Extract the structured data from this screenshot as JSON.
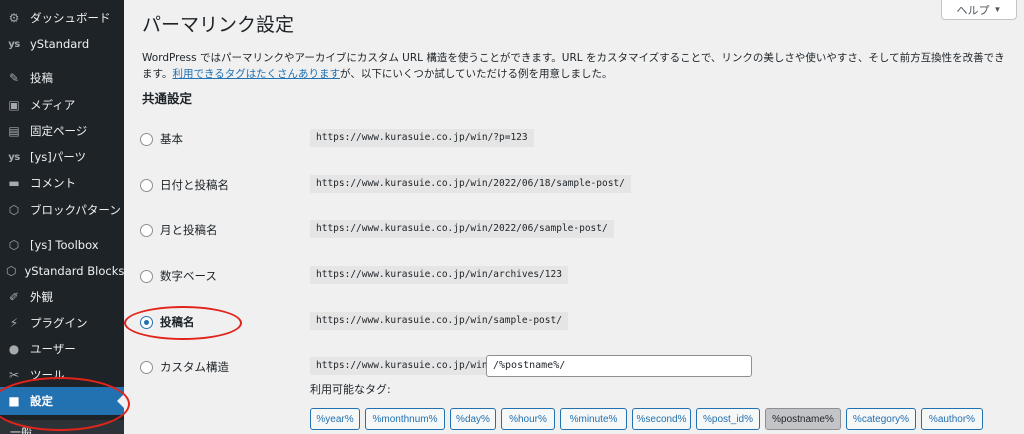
{
  "sidebar": {
    "items": [
      {
        "icon": "dashboard-icon",
        "glyph": "⚙",
        "label": "ダッシュボード"
      },
      {
        "icon": "ystandard-icon",
        "glyph": "ys",
        "label": "yStandard"
      },
      {
        "icon": "pin-icon",
        "glyph": "✎",
        "label": "投稿"
      },
      {
        "icon": "media-icon",
        "glyph": "▣",
        "label": "メディア"
      },
      {
        "icon": "page-icon",
        "glyph": "▤",
        "label": "固定ページ"
      },
      {
        "icon": "ys-parts-icon",
        "glyph": "ys",
        "label": "[ys]パーツ"
      },
      {
        "icon": "comment-icon",
        "glyph": "▬",
        "label": "コメント"
      },
      {
        "icon": "block-pattern-icon",
        "glyph": "⬡",
        "label": "ブロックパターン"
      },
      {
        "icon": "ys-toolbox-icon",
        "glyph": "⬡",
        "label": "[ys] Toolbox"
      },
      {
        "icon": "ystandard-blocks-icon",
        "glyph": "⬡",
        "label": "yStandard Blocks"
      },
      {
        "icon": "appearance-icon",
        "glyph": "✐",
        "label": "外観"
      },
      {
        "icon": "plugin-icon",
        "glyph": "⚡",
        "label": "プラグイン"
      },
      {
        "icon": "user-icon",
        "glyph": "●",
        "label": "ユーザー"
      },
      {
        "icon": "tools-icon",
        "glyph": "✂",
        "label": "ツール"
      },
      {
        "icon": "settings-icon",
        "glyph": "■",
        "label": "設定"
      }
    ],
    "submenu_label": "一般"
  },
  "header": {
    "title": "パーマリンク設定",
    "help_label": "ヘルプ",
    "help_arrow": "▼"
  },
  "intro": {
    "text_before": "WordPress ではパーマリンクやアーカイブにカスタム URL 構造を使うことができます。URL をカスタマイズすることで、リンクの美しさや使いやすさ、そして前方互換性を改善できます。",
    "link_text": "利用できるタグはたくさんあります",
    "text_after": "が、以下にいくつか試していただける例を用意しました。"
  },
  "common_settings": {
    "title": "共通設定",
    "options": [
      {
        "label": "基本",
        "url": "https://www.kurasuie.co.jp/win/?p=123",
        "checked": false
      },
      {
        "label": "日付と投稿名",
        "url": "https://www.kurasuie.co.jp/win/2022/06/18/sample-post/",
        "checked": false
      },
      {
        "label": "月と投稿名",
        "url": "https://www.kurasuie.co.jp/win/2022/06/sample-post/",
        "checked": false
      },
      {
        "label": "数字ベース",
        "url": "https://www.kurasuie.co.jp/win/archives/123",
        "checked": false
      },
      {
        "label": "投稿名",
        "url": "https://www.kurasuie.co.jp/win/sample-post/",
        "checked": true
      },
      {
        "label": "カスタム構造",
        "url": "https://www.kurasuie.co.jp/win",
        "checked": false
      }
    ],
    "custom_value": "/%postname%/",
    "tags_label": "利用可能なタグ:",
    "tags": [
      {
        "label": "%year%",
        "active": false
      },
      {
        "label": "%monthnum%",
        "active": false
      },
      {
        "label": "%day%",
        "active": false
      },
      {
        "label": "%hour%",
        "active": false
      },
      {
        "label": "%minute%",
        "active": false
      },
      {
        "label": "%second%",
        "active": false
      },
      {
        "label": "%post_id%",
        "active": false
      },
      {
        "label": "%postname%",
        "active": true
      },
      {
        "label": "%category%",
        "active": false
      },
      {
        "label": "%author%",
        "active": false
      }
    ]
  },
  "colors": {
    "sidebar_bg": "#1d2327",
    "accent": "#2271b1",
    "annotation": "#e2231a"
  }
}
